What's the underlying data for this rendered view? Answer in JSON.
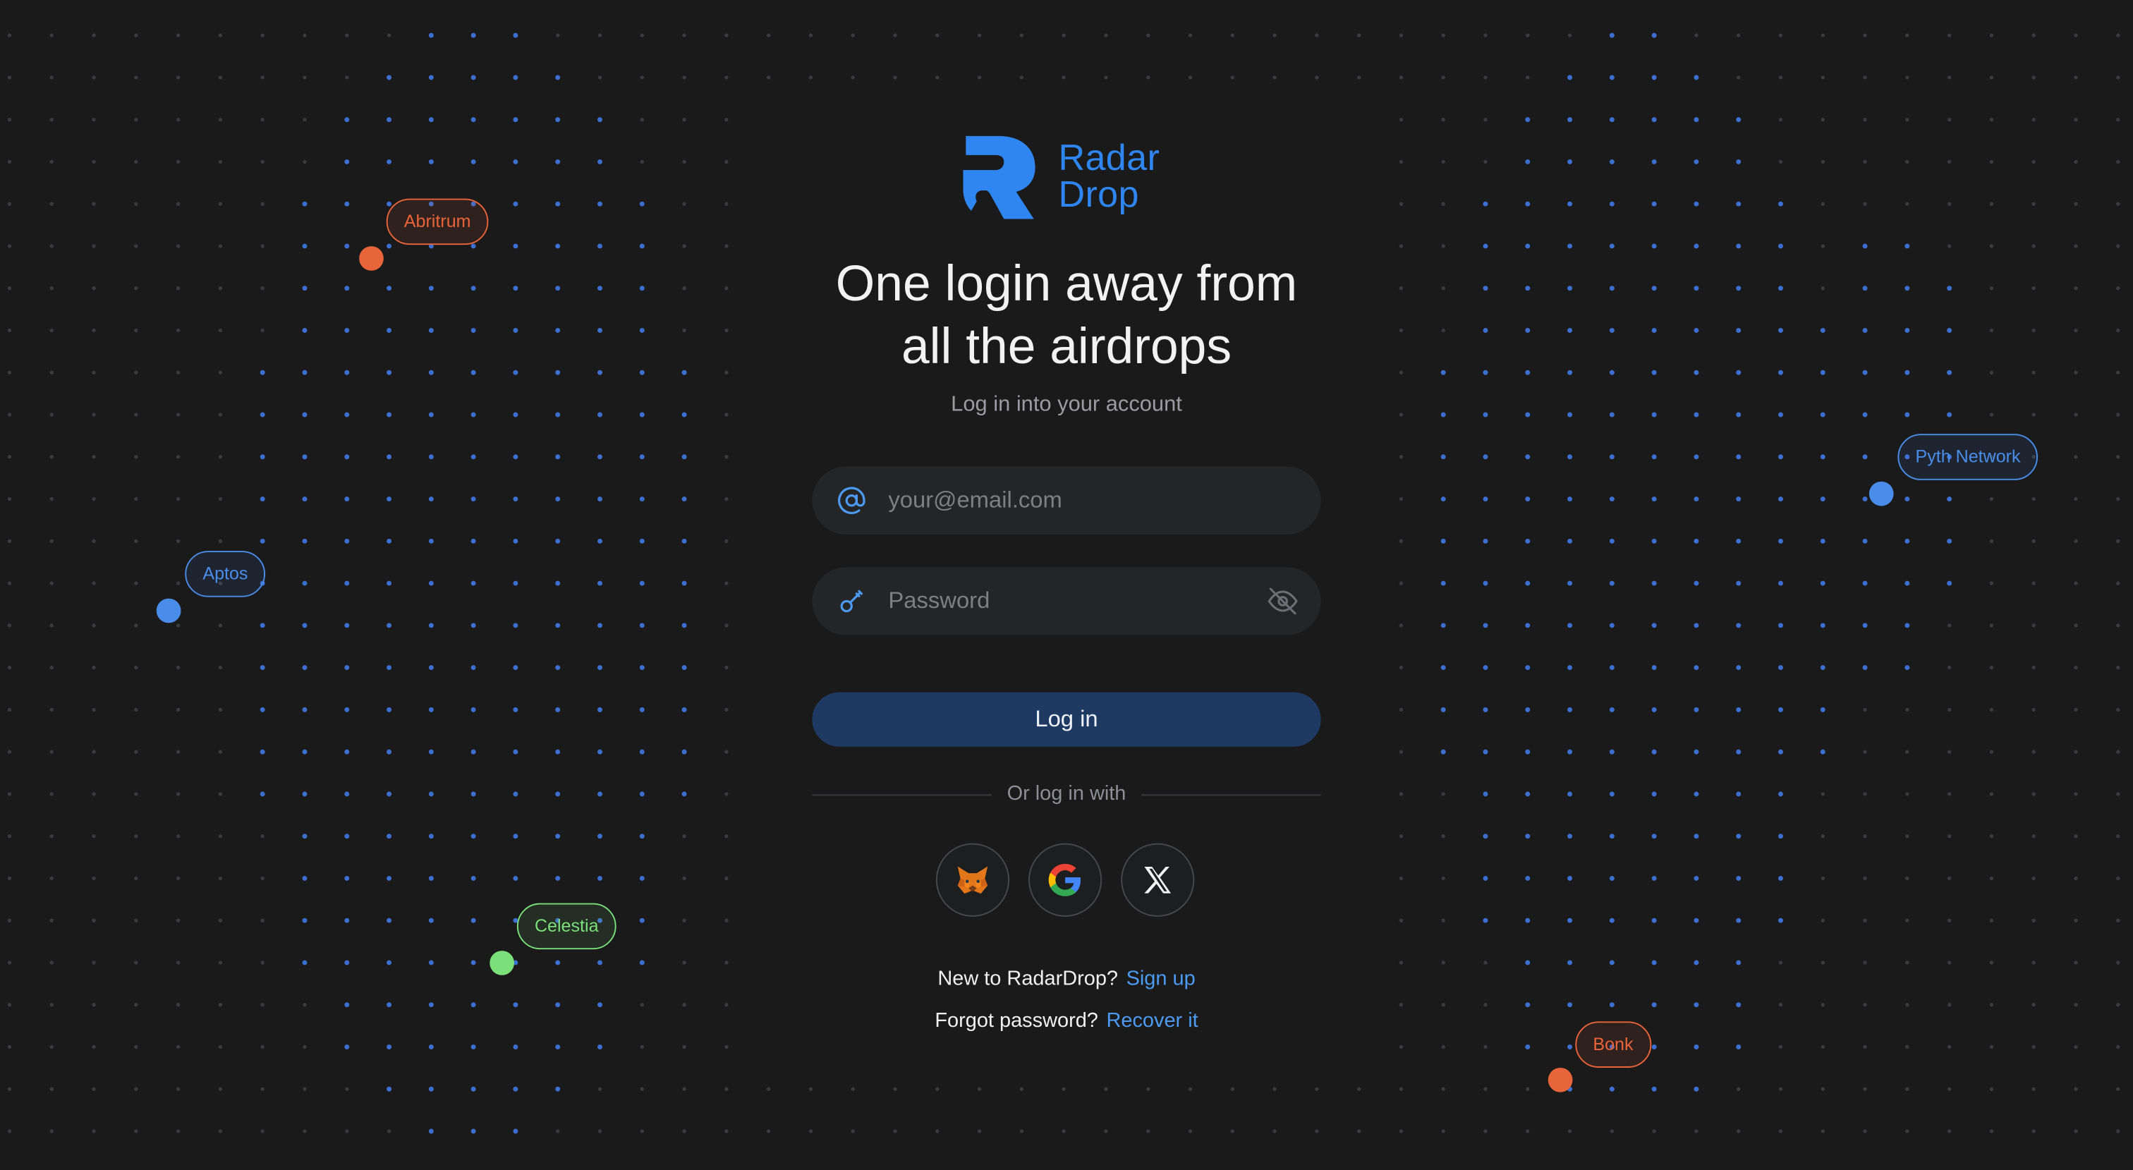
{
  "brand": {
    "name_line1": "Radar",
    "name_line2": "Drop",
    "color": "#2f86f0"
  },
  "headline": {
    "line1": "One login away from",
    "line2": "all the airdrops"
  },
  "subtitle": "Log in into your account",
  "form": {
    "email_placeholder": "your@email.com",
    "password_placeholder": "Password",
    "email_icon": "at-sign-icon",
    "password_icon": "key-icon",
    "toggle_icon": "eye-off-icon",
    "login_label": "Log in"
  },
  "divider_text": "Or log in with",
  "social": [
    {
      "name": "metamask",
      "icon": "metamask-fox-icon"
    },
    {
      "name": "google",
      "icon": "google-g-icon"
    },
    {
      "name": "x",
      "icon": "x-logo-icon"
    }
  ],
  "footer": {
    "signup_prompt": "New to RadarDrop?",
    "signup_link": "Sign up",
    "recover_prompt": "Forgot password?",
    "recover_link": "Recover it"
  },
  "tags": [
    {
      "label": "Abritrum",
      "color": "#e8643a"
    },
    {
      "label": "Aptos",
      "color": "#4a8de8"
    },
    {
      "label": "Celestia",
      "color": "#7be07a"
    },
    {
      "label": "Pyth Network",
      "color": "#4a8de8"
    },
    {
      "label": "Bonk",
      "color": "#e8643a"
    }
  ],
  "colors": {
    "background": "#1a1a1b",
    "field_bg": "#232527",
    "button_bg": "#1e3a63",
    "link": "#4d9af2",
    "dot_blue": "#3d6fd0",
    "dot_gray": "#3a3b3e"
  }
}
